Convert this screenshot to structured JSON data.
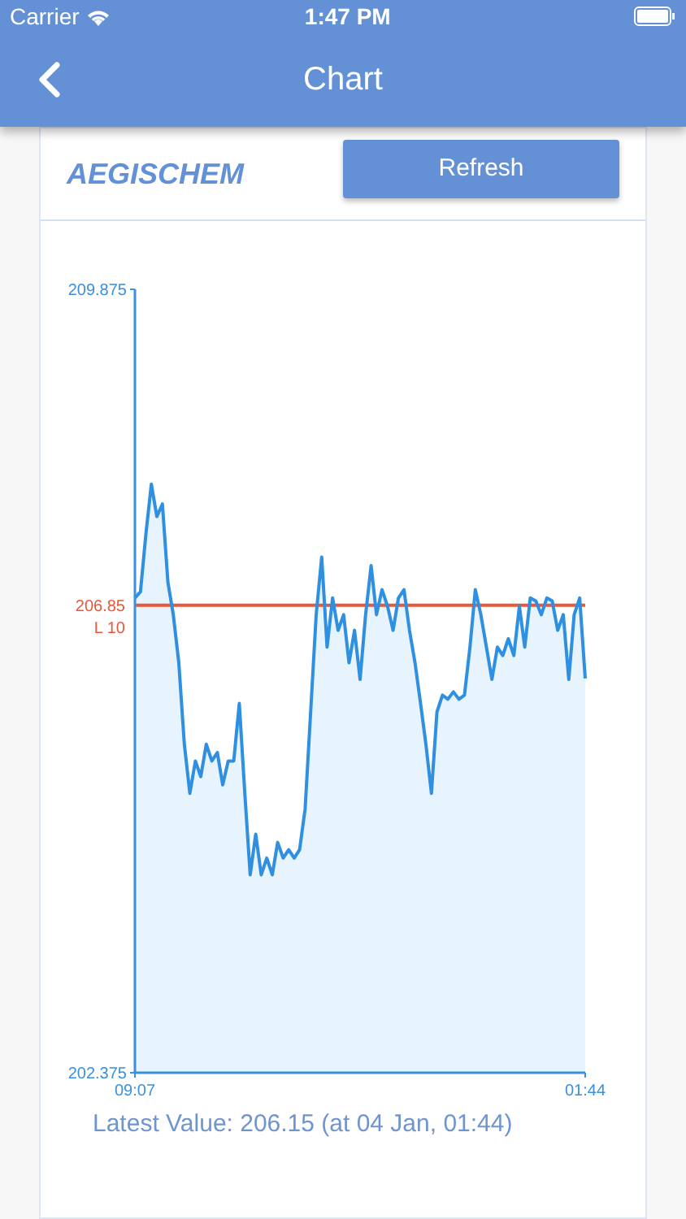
{
  "status_bar": {
    "carrier": "Carrier",
    "time": "1:47 PM"
  },
  "nav": {
    "title": "Chart"
  },
  "card": {
    "title": "AEGISCHEM",
    "refresh_button": "Refresh",
    "chart_data": {
      "type": "area",
      "categories": [
        "09:07",
        null,
        null,
        null,
        null,
        null,
        null,
        null,
        null,
        null,
        null,
        null,
        null,
        null,
        null,
        null,
        null,
        null,
        null,
        null,
        null,
        null,
        null,
        null,
        null,
        null,
        null,
        null,
        null,
        null,
        null,
        null,
        null,
        null,
        null,
        null,
        null,
        null,
        null,
        null,
        null,
        null,
        null,
        null,
        null,
        null,
        null,
        null,
        null,
        null,
        null,
        null,
        null,
        null,
        null,
        null,
        null,
        null,
        null,
        null,
        null,
        null,
        null,
        null,
        null,
        null,
        null,
        null,
        null,
        null,
        null,
        null,
        null,
        null,
        null,
        null,
        null,
        null,
        null,
        null,
        null,
        null,
        "01:44"
      ],
      "ylim": [
        202.375,
        209.875
      ],
      "yticks": [
        202.375,
        206.85,
        209.875
      ],
      "series": [
        {
          "color": "#2f8fe0",
          "values": [
            206.92,
            206.98,
            207.54,
            208.01,
            207.7,
            207.82,
            207.07,
            206.76,
            206.3,
            205.52,
            205.05,
            205.36,
            205.21,
            205.52,
            205.36,
            205.44,
            205.13,
            205.36,
            205.36,
            205.91,
            205.05,
            204.27,
            204.66,
            204.27,
            204.43,
            204.27,
            204.58,
            204.43,
            204.51,
            204.43,
            204.51,
            204.9,
            205.83,
            206.76,
            207.31,
            206.45,
            206.92,
            206.61,
            206.76,
            206.3,
            206.61,
            206.14,
            206.76,
            207.23,
            206.76,
            207.0,
            206.84,
            206.61,
            206.92,
            207.0,
            206.61,
            206.3,
            205.91,
            205.52,
            205.05,
            205.83,
            205.99,
            205.95,
            206.02,
            205.95,
            205.99,
            206.45,
            207.0,
            206.76,
            206.45,
            206.14,
            206.45,
            206.37,
            206.53,
            206.37,
            206.84,
            206.45,
            206.92,
            206.89,
            206.76,
            206.92,
            206.89,
            206.61,
            206.76,
            206.14,
            206.76,
            206.92,
            206.15
          ]
        },
        {
          "name": "L 10",
          "type": "line",
          "color": "#e8583a",
          "values": [
            206.85,
            206.85,
            206.85,
            206.85,
            206.85,
            206.85,
            206.85,
            206.85,
            206.85,
            206.85,
            206.85,
            206.85,
            206.85,
            206.85,
            206.85,
            206.85,
            206.85,
            206.85,
            206.85,
            206.85,
            206.85,
            206.85,
            206.85,
            206.85,
            206.85,
            206.85,
            206.85,
            206.85,
            206.85,
            206.85,
            206.85,
            206.85,
            206.85,
            206.85,
            206.85,
            206.85,
            206.85,
            206.85,
            206.85,
            206.85,
            206.85,
            206.85,
            206.85,
            206.85,
            206.85,
            206.85,
            206.85,
            206.85,
            206.85,
            206.85,
            206.85,
            206.85,
            206.85,
            206.85,
            206.85,
            206.85,
            206.85,
            206.85,
            206.85,
            206.85,
            206.85,
            206.85,
            206.85,
            206.85,
            206.85,
            206.85,
            206.85,
            206.85,
            206.85,
            206.85,
            206.85,
            206.85,
            206.85,
            206.85,
            206.85,
            206.85,
            206.85,
            206.85,
            206.85,
            206.85,
            206.85,
            206.85,
            206.85
          ]
        }
      ]
    },
    "latest_value": "Latest Value: 206.15 (at 04 Jan, 01:44)"
  }
}
